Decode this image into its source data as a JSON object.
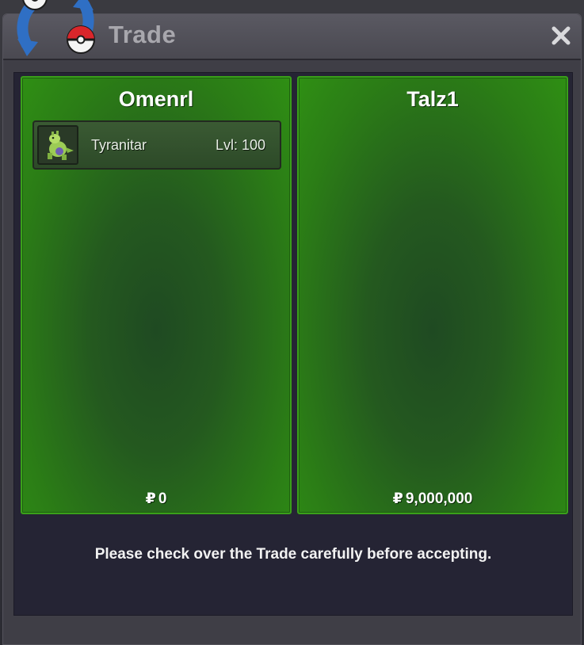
{
  "window": {
    "title": "Trade",
    "close_icon": "close-icon"
  },
  "left_panel": {
    "player": "Omenrl",
    "money_symbol": "₽",
    "money": "0",
    "items": [
      {
        "name": "Tyranitar",
        "level": "Lvl: 100",
        "icon": "tyranitar-sprite-icon"
      }
    ]
  },
  "right_panel": {
    "player": "Talz1",
    "money_symbol": "₽",
    "money": "9,000,000",
    "items": []
  },
  "notice": "Please check over the Trade carefully before accepting.",
  "colors": {
    "panel_green": "#2f8f14",
    "panel_border": "#3aa01a",
    "window_bg": "#3f3e46",
    "content_bg": "#252434"
  }
}
